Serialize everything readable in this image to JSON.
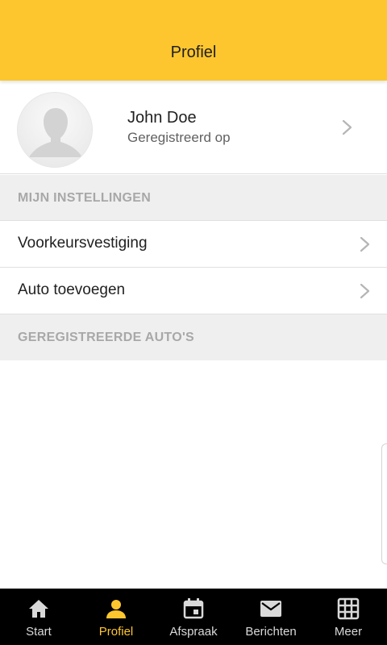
{
  "header": {
    "title": "Profiel"
  },
  "profile": {
    "name": "John Doe",
    "subtitle": "Geregistreerd op"
  },
  "sections": {
    "settings_title": "MIJN INSTELLINGEN",
    "cars_title": "GEREGISTREERDE AUTO'S"
  },
  "settings_items": [
    {
      "label": "Voorkeursvestiging",
      "icon": "chevron-right-icon"
    },
    {
      "label": "Auto toevoegen",
      "icon": "chevron-right-icon"
    }
  ],
  "nav": {
    "items": [
      {
        "label": "Start",
        "icon": "home-icon"
      },
      {
        "label": "Profiel",
        "icon": "person-icon",
        "active": true
      },
      {
        "label": "Afspraak",
        "icon": "calendar-icon"
      },
      {
        "label": "Berichten",
        "icon": "mail-icon"
      },
      {
        "label": "Meer",
        "icon": "grid-icon"
      }
    ]
  },
  "colors": {
    "accent": "#fdc62f",
    "nav_background": "#000000",
    "section_background": "#efefef",
    "section_text": "#a8a8a8"
  }
}
